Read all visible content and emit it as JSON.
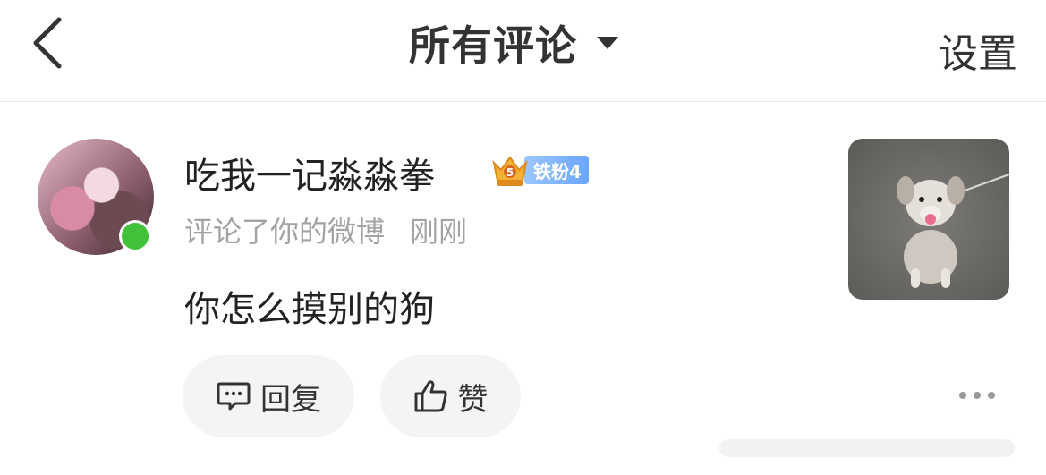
{
  "header": {
    "back_icon": "chevron-left-icon",
    "title": "所有评论",
    "dropdown_icon": "caret-down-icon",
    "settings_label": "设置"
  },
  "comment": {
    "username": "吃我一记淼淼拳",
    "crown_badge_level": "5",
    "fan_badge_label": "铁粉4",
    "action_text": "评论了你的微博",
    "timestamp": "刚刚",
    "text": "你怎么摸别的狗",
    "online_status_color": "#41c23a",
    "thumbnail_icon": "dog-photo"
  },
  "actions": {
    "reply_label": "回复",
    "reply_icon": "comment-icon",
    "like_label": "赞",
    "like_icon": "thumbs-up-icon",
    "more_icon": "more-dots-icon"
  }
}
